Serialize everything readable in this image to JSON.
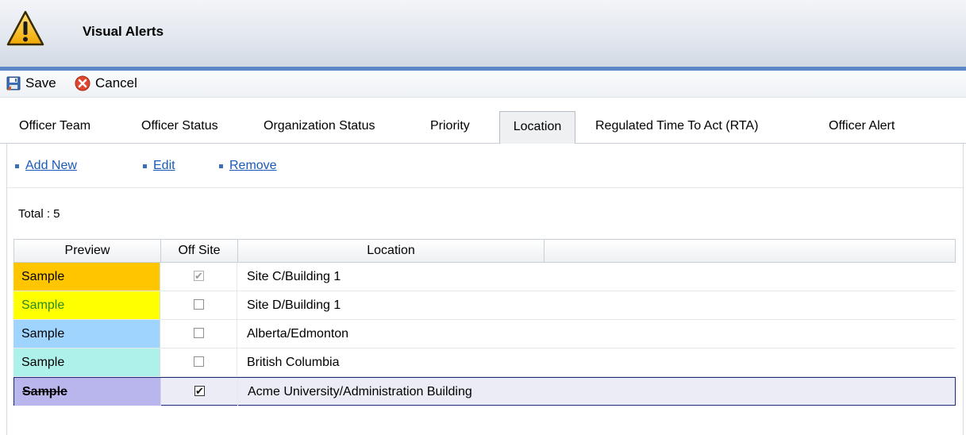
{
  "header": {
    "title": "Visual Alerts",
    "icon": "warning-icon"
  },
  "toolbar": {
    "save_label": "Save",
    "cancel_label": "Cancel"
  },
  "tabs": [
    {
      "label": "Officer Team"
    },
    {
      "label": "Officer Status"
    },
    {
      "label": "Organization Status"
    },
    {
      "label": "Priority"
    },
    {
      "label": "Location",
      "active": true
    },
    {
      "label": "Regulated Time To Act (RTA)"
    },
    {
      "label": "Officer Alert"
    }
  ],
  "actions": {
    "add_new": "Add New",
    "edit": "Edit",
    "remove": "Remove"
  },
  "total_label": "Total : 5",
  "grid": {
    "columns": [
      "Preview",
      "Off Site",
      "Location"
    ],
    "rows": [
      {
        "preview": "Sample",
        "bg": "#ffc600",
        "fg": "#000000",
        "off_site": true,
        "location": "Site C/Building 1"
      },
      {
        "preview": "Sample",
        "bg": "#ffff00",
        "fg": "#2a8a1a",
        "off_site": false,
        "location": "Site D/Building 1"
      },
      {
        "preview": "Sample",
        "bg": "#9fd4ff",
        "fg": "#000000",
        "off_site": false,
        "location": "Alberta/Edmonton"
      },
      {
        "preview": "Sample",
        "bg": "#aef0ea",
        "fg": "#000000",
        "off_site": false,
        "location": "British Columbia"
      },
      {
        "preview": "Sample",
        "bg": "#b9b6ee",
        "fg": "#000000",
        "off_site": true,
        "location": "Acme University/Administration Building",
        "selected": true,
        "strikethrough": true
      }
    ]
  }
}
